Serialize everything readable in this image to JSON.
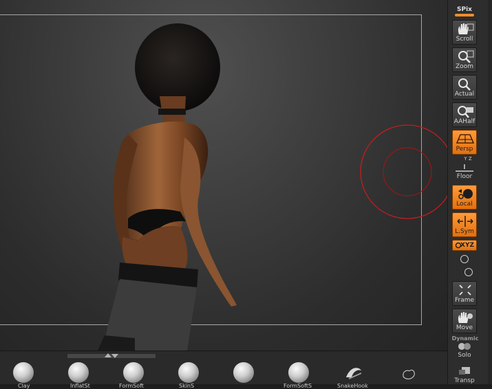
{
  "shelf": {
    "spix_label": "SPix",
    "buttons": [
      {
        "label": "Scroll",
        "icon": "hand-scroll-icon"
      },
      {
        "label": "Zoom",
        "icon": "magnifier-zoom-icon"
      },
      {
        "label": "Actual",
        "icon": "magnifier-actual-icon"
      },
      {
        "label": "AAHalf",
        "icon": "magnifier-aahalf-icon"
      },
      {
        "label": "Persp",
        "icon": "perspective-grid-icon",
        "active": true
      },
      {
        "label": "Floor",
        "icon": "floor-grid-icon"
      },
      {
        "label": "Local",
        "icon": "local-pivot-icon",
        "active": true
      },
      {
        "label": "L.Sym",
        "icon": "local-symmetry-icon",
        "active": true
      },
      {
        "label": "XYZ",
        "icon": "rotate-xyz-icon",
        "active": true
      },
      {
        "label": "Frame",
        "icon": "frame-icon"
      },
      {
        "label": "Move",
        "icon": "hand-move-icon"
      },
      {
        "label": "Solo",
        "icon": "solo-icon"
      },
      {
        "label": "Transp",
        "icon": "transparency-icon"
      }
    ],
    "xyz_small": "Y Z",
    "dynamic_label": "Dynamic"
  },
  "tray": {
    "brushes": [
      {
        "label": "Clay"
      },
      {
        "label": "InflatSt"
      },
      {
        "label": "FormSoft"
      },
      {
        "label": "SkinS"
      },
      {
        "label": ""
      },
      {
        "label": "FormSoftS"
      },
      {
        "label": "SnakeHook"
      },
      {
        "label": ""
      }
    ]
  },
  "colors": {
    "active": "#f28c28",
    "cursor": "#c41d1d"
  }
}
